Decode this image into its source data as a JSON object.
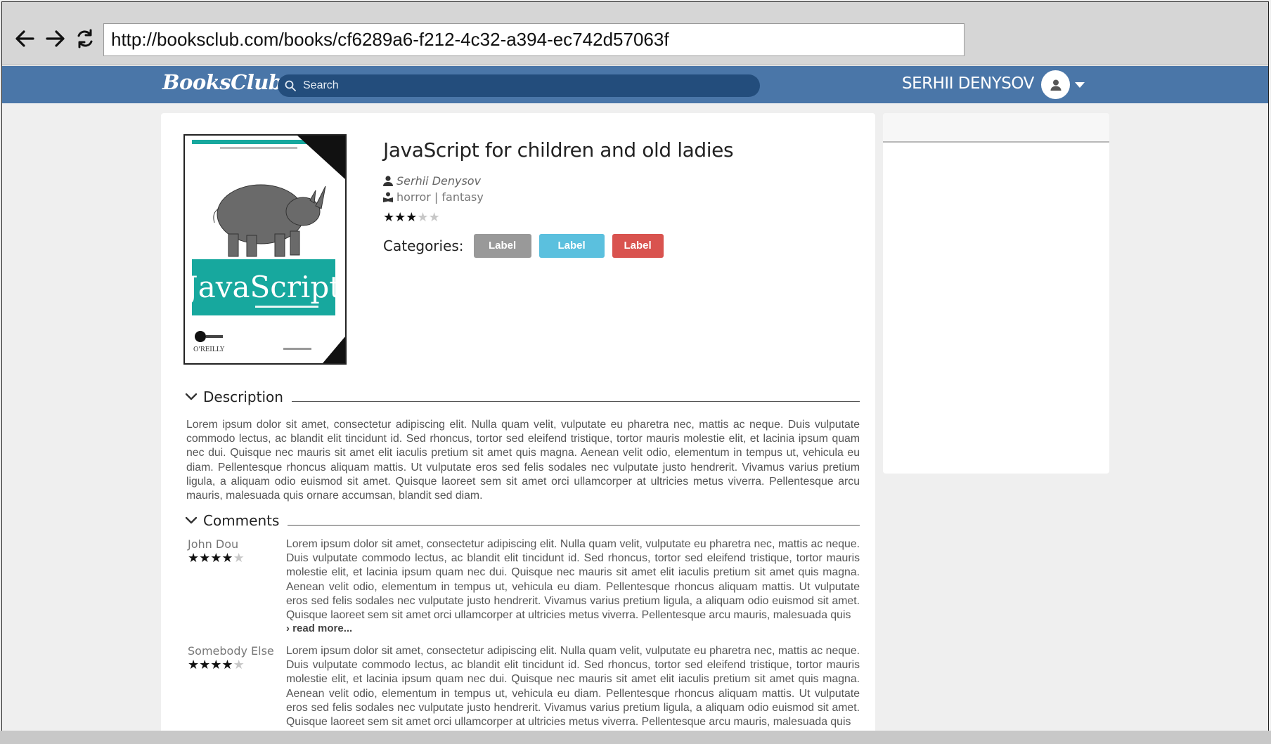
{
  "browser": {
    "url": "http://booksclub.com/books/cf6289a6-f212-4c32-a394-ec742d57063f"
  },
  "header": {
    "logo": "BooksClub",
    "search_placeholder": "Search",
    "user_name": "SERHII DENYSOV"
  },
  "book": {
    "title": "JavaScript for children and old ladies",
    "author": "Serhii Denysov",
    "genres": "horror | fantasy",
    "rating": 3,
    "rating_max": 5,
    "categories_label": "Categories:",
    "categories": [
      {
        "label": "Label",
        "color": "#999999"
      },
      {
        "label": "Label",
        "color": "#5bc0de"
      },
      {
        "label": "Label",
        "color": "#d9534f"
      }
    ],
    "cover": {
      "title": "JavaScript",
      "publisher": "O'REILLY",
      "accent": "#17a89e"
    }
  },
  "description": {
    "heading": "Description",
    "text": "Lorem ipsum dolor sit amet, consectetur adipiscing elit. Nulla quam velit, vulputate eu pharetra nec, mattis ac neque. Duis vulputate commodo lectus, ac blandit elit tincidunt id. Sed rhoncus, tortor sed eleifend tristique, tortor mauris molestie elit, et lacinia ipsum quam nec dui. Quisque nec mauris sit amet elit iaculis pretium sit amet quis magna. Aenean velit odio, elementum in tempus ut, vehicula eu diam. Pellentesque rhoncus aliquam mattis. Ut vulputate eros sed felis sodales nec vulputate justo hendrerit. Vivamus varius pretium ligula, a aliquam odio euismod sit amet. Quisque laoreet sem sit amet orci ullamcorper at ultricies metus viverra. Pellentesque arcu mauris, malesuada quis ornare accumsan, blandit sed diam."
  },
  "comments": {
    "heading": "Comments",
    "read_more": "read more...",
    "items": [
      {
        "author": "John Dou",
        "rating": 4,
        "text": "Lorem ipsum dolor sit amet, consectetur adipiscing elit. Nulla quam velit, vulputate eu pharetra nec, mattis ac neque. Duis vulputate commodo lectus, ac blandit elit tincidunt id. Sed rhoncus, tortor sed eleifend tristique, tortor mauris molestie elit, et lacinia ipsum quam nec dui. Quisque nec mauris sit amet elit iaculis pretium sit amet quis magna. Aenean velit odio, elementum in tempus ut, vehicula eu diam. Pellentesque rhoncus aliquam mattis. Ut vulputate eros sed felis sodales nec vulputate justo hendrerit. Vivamus varius pretium ligula, a aliquam odio euismod sit amet. Quisque laoreet sem sit amet orci ullamcorper at ultricies metus viverra. Pellentesque arcu mauris, malesuada quis"
      },
      {
        "author": "Somebody Else",
        "rating": 4,
        "text": "Lorem ipsum dolor sit amet, consectetur adipiscing elit. Nulla quam velit, vulputate eu pharetra nec, mattis ac neque. Duis vulputate commodo lectus, ac blandit elit tincidunt id. Sed rhoncus, tortor sed eleifend tristique, tortor mauris molestie elit, et lacinia ipsum quam nec dui. Quisque nec mauris sit amet elit iaculis pretium sit amet quis magna. Aenean velit odio, elementum in tempus ut, vehicula eu diam. Pellentesque rhoncus aliquam mattis. Ut vulputate eros sed felis sodales nec vulputate justo hendrerit. Vivamus varius pretium ligula, a aliquam odio euismod sit amet. Quisque laoreet sem sit amet orci ullamcorper at ultricies metus viverra. Pellentesque arcu mauris, malesuada quis"
      }
    ]
  }
}
